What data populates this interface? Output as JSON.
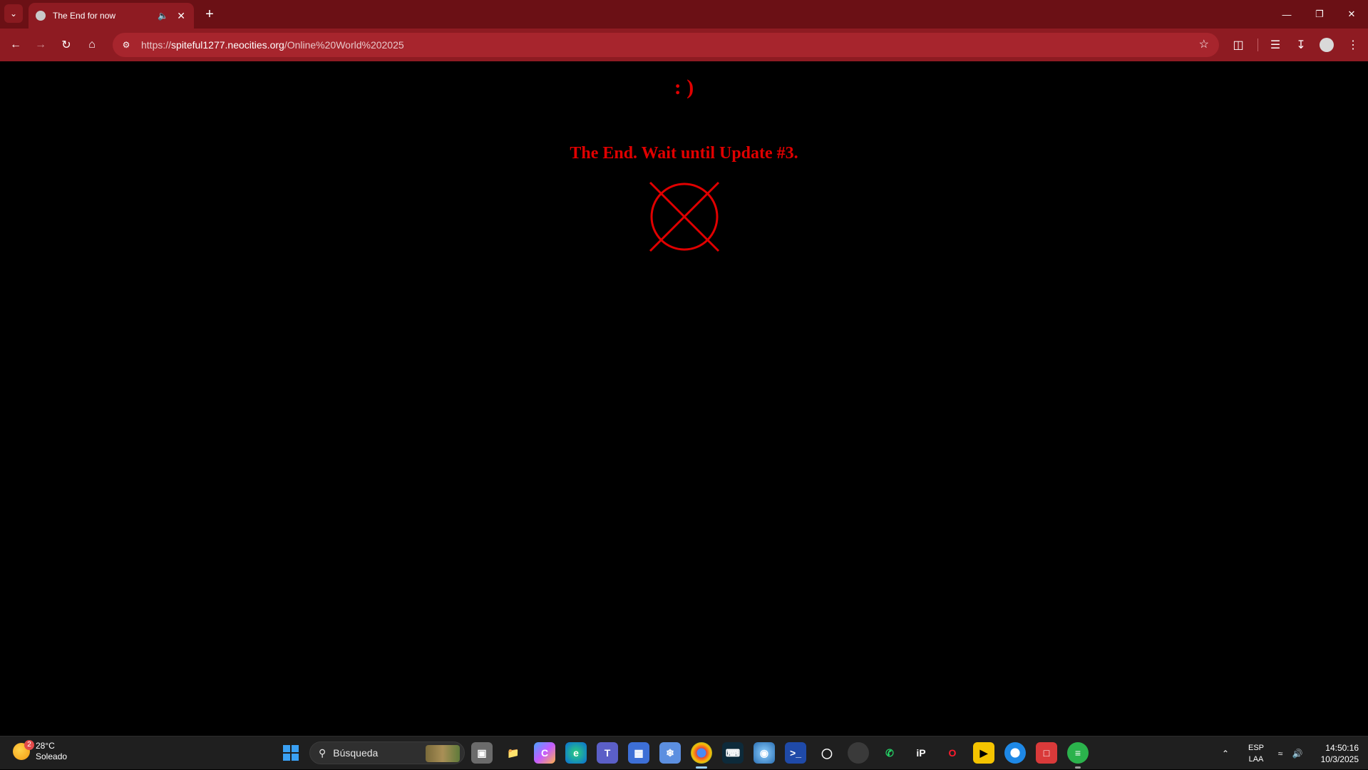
{
  "browser": {
    "tab_title": "The End for now",
    "url_scheme": "https://",
    "url_host": "spiteful1277.neocities.org",
    "url_path": "/Online%20World%202025"
  },
  "page": {
    "smiley": ": )",
    "heading": "The End. Wait until Update #3.",
    "accent_color": "#e00000"
  },
  "taskbar": {
    "weather_temp": "28°C",
    "weather_desc": "Soleado",
    "weather_badge": "2",
    "search_placeholder": "Búsqueda",
    "lang_line1": "ESP",
    "lang_line2": "LAA",
    "time": "14:50:16",
    "date": "10/3/2025"
  }
}
